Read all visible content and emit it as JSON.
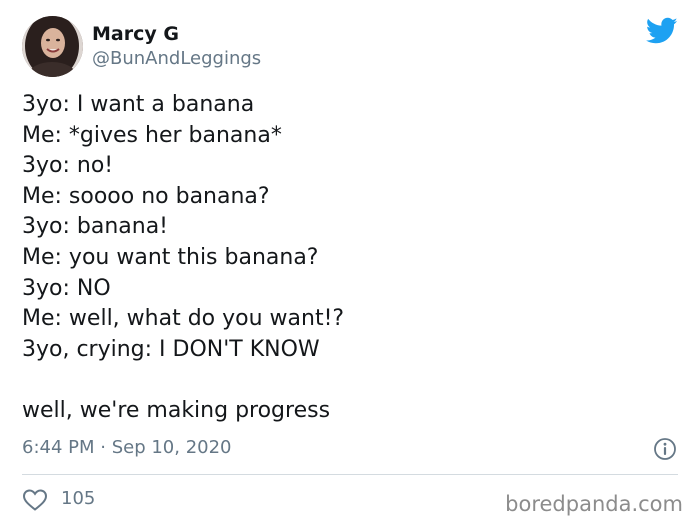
{
  "author": {
    "name": "Marcy G",
    "handle": "@BunAndLeggings",
    "avatar_icon": "profile-photo"
  },
  "brand": {
    "icon": "twitter-bird-icon",
    "color": "#1da1f2"
  },
  "tweet": {
    "lines": [
      "3yo: I want a banana",
      "Me: *gives her banana*",
      "3yo: no!",
      "Me: soooo no banana?",
      "3yo: banana!",
      "Me: you want this banana?",
      "3yo: NO",
      "Me: well, what do you want!?",
      "3yo, crying: I DON'T KNOW",
      "",
      "well, we're making progress"
    ]
  },
  "meta": {
    "timestamp": "6:44 PM · Sep 10, 2020",
    "info_icon": "info-icon"
  },
  "engagement": {
    "like_icon": "heart-icon",
    "likes": "105"
  },
  "watermark": "boredpanda.com",
  "colors": {
    "text": "#14171a",
    "secondary": "#657786",
    "divider": "#d4dbe0"
  }
}
